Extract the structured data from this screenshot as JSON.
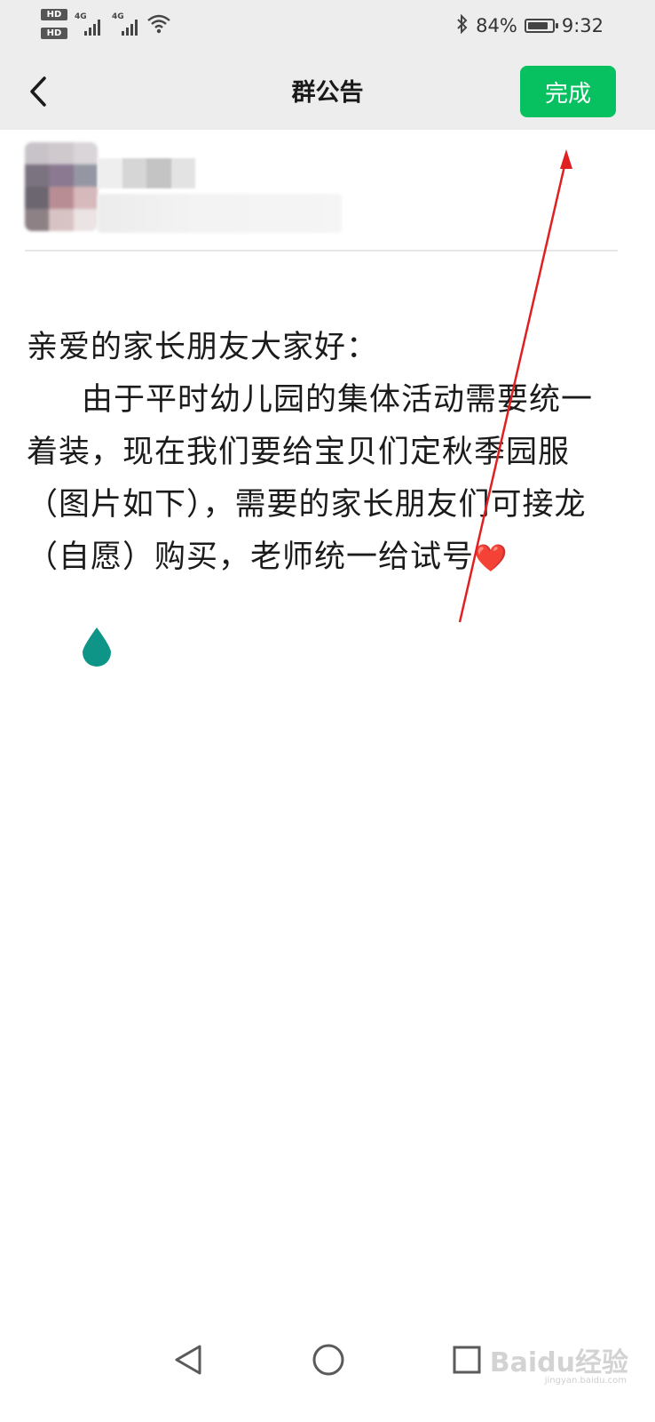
{
  "status_bar": {
    "hd1": "HD",
    "hd2": "HD",
    "sim1_label": "4G",
    "sim2_label": "4G",
    "battery_percent": "84%",
    "battery_level": 0.84,
    "time": "9:32",
    "icons": [
      "signal-icon",
      "wifi-icon",
      "bluetooth-icon",
      "battery-icon"
    ]
  },
  "nav": {
    "back_icon": "chevron-left-icon",
    "title": "群公告",
    "done_label": "完成",
    "done_color": "#07c160"
  },
  "announcement": {
    "greeting": "亲爱的家长朋友大家好：",
    "body": "由于平时幼儿园的集体活动需要统一着装，现在我们要给宝贝们定秋季园服（图片如下），需要的家长朋友们可接龙（自愿）购买，老师统一给试号",
    "emoji": "❤️"
  },
  "system_nav": {
    "back_icon": "triangle-back-icon",
    "home_icon": "circle-home-icon",
    "recents_icon": "square-recents-icon"
  },
  "watermark": {
    "text": "Baidu经验",
    "sub": "jingyan.baidu.com"
  },
  "colors": {
    "accent": "#07c160",
    "header_bg": "#ededed",
    "annotation": "#e02020",
    "cursor": "#0f9488"
  }
}
